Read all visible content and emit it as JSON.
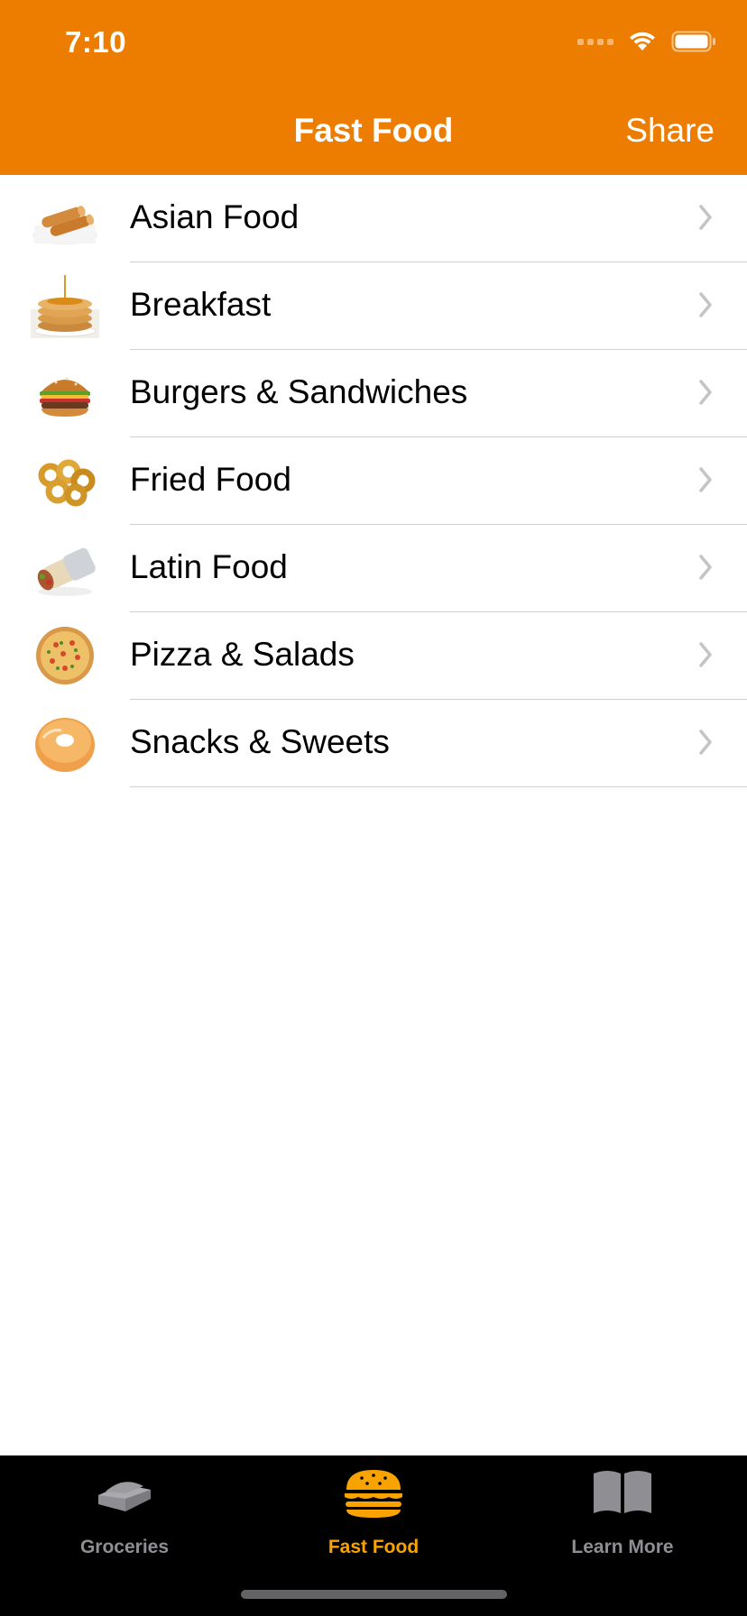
{
  "status": {
    "time": "7:10"
  },
  "nav": {
    "title": "Fast Food",
    "share": "Share"
  },
  "categories": [
    {
      "label": "Asian Food",
      "icon": "spring-rolls-icon"
    },
    {
      "label": "Breakfast",
      "icon": "pancakes-icon"
    },
    {
      "label": "Burgers & Sandwiches",
      "icon": "burger-icon"
    },
    {
      "label": "Fried Food",
      "icon": "onion-rings-icon"
    },
    {
      "label": "Latin Food",
      "icon": "burrito-icon"
    },
    {
      "label": "Pizza & Salads",
      "icon": "pizza-icon"
    },
    {
      "label": "Snacks & Sweets",
      "icon": "donut-icon"
    }
  ],
  "tabs": [
    {
      "label": "Groceries",
      "icon": "groceries-icon",
      "active": false
    },
    {
      "label": "Fast Food",
      "icon": "burger-icon",
      "active": true
    },
    {
      "label": "Learn More",
      "icon": "book-icon",
      "active": false
    }
  ],
  "colors": {
    "accent": "#ed7d00",
    "tab_active": "#f9a300",
    "tab_inactive": "#8e8e93",
    "separator": "#cfcfd3",
    "chevron": "#c4c4c7"
  }
}
